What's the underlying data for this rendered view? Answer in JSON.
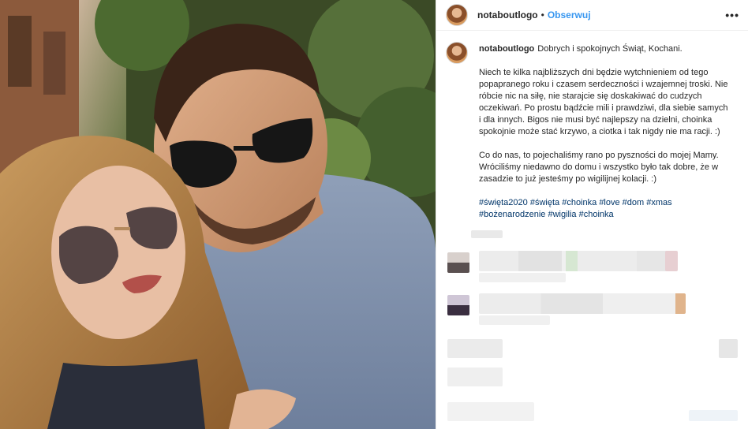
{
  "post": {
    "username": "notaboutlogo",
    "separator": "•",
    "follow_label": "Obserwuj",
    "more_label": "•••"
  },
  "caption": {
    "username": "notaboutlogo",
    "line1": "Dobrych i spokojnych Świąt, Kochani.",
    "para1": "Niech te kilka najbliższych dni będzie wytchnieniem od tego popapranego roku i czasem serdeczności i wzajemnej troski. Nie róbcie nic na siłę, nie starajcie się doskakiwać do cudzych oczekiwań. Po prostu bądźcie mili i prawdziwi, dla siebie samych i dla innych. Bigos nie musi być najlepszy na dzielni, choinka spokojnie może stać krzywo, a ciotka i tak nigdy nie ma racji. :)",
    "para2": "Co do nas, to pojechaliśmy rano po pyszności do mojej Mamy. Wróciliśmy niedawno do domu i wszystko było tak dobre, że w zasadzie to już jesteśmy po wigilijnej kolacji. :)",
    "hashtags": [
      "#święta2020",
      "#święta",
      "#choinka",
      "#love",
      "#dom",
      "#xmas",
      "#bożenarodzenie",
      "#wigilia",
      "#choinka"
    ]
  },
  "icons": {
    "profile_avatar": "avatar",
    "more_options": "more-icon"
  },
  "colors": {
    "link": "#3897f0",
    "hashtag": "#003569",
    "text": "#262626",
    "border": "#efefef"
  }
}
